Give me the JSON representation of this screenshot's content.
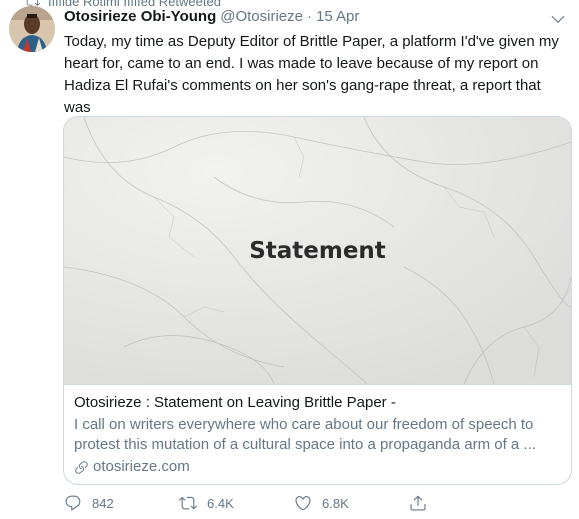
{
  "social_context": {
    "text": "Ifffide Rotimi Iffffed Retweeted"
  },
  "tweet": {
    "display_name": "Otosirieze Obi-Young",
    "handle": "@Otosirieze",
    "separator": "·",
    "time": "15 Apr",
    "text": "Today, my time as Deputy Editor of Brittle Paper, a platform I'd've given my\nheart for, came to an end. I was made to leave because of my report on\nHadiza El Rufai's comments on her son's gang-rape threat, a report that was\ntaken down. My statement."
  },
  "card": {
    "image_text": "Statement",
    "title": "Otosirieze : Statement on Leaving Brittle Paper -",
    "description_line1": "I call on writers everywhere who care about our freedom of speech to",
    "description_line2": "protest this mutation of a cultural space into a propaganda arm of a ...",
    "domain": "otosirieze.com"
  },
  "actions": {
    "reply_count": "842",
    "retweet_count": "6.4K",
    "like_count": "6.8K"
  },
  "colors": {
    "text_primary": "#14171a",
    "text_secondary": "#657786",
    "border": "#cfd9de",
    "card_image_bg": "#e9e9e8"
  },
  "icons": [
    "retweet-icon",
    "caret-down-icon",
    "link-icon",
    "reply-icon",
    "retweet-icon",
    "like-icon",
    "share-icon"
  ]
}
